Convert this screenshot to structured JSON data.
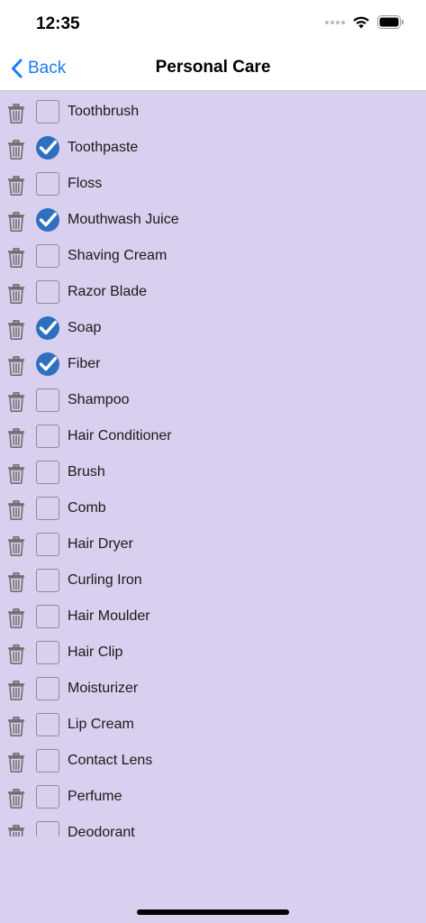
{
  "status": {
    "time": "12:35"
  },
  "nav": {
    "back_label": "Back",
    "title": "Personal Care"
  },
  "colors": {
    "accent": "#1b7cf5",
    "background": "#d9cfee",
    "check_fill": "#2f6fbf"
  },
  "items": [
    {
      "label": "Toothbrush",
      "checked": false
    },
    {
      "label": "Toothpaste",
      "checked": true
    },
    {
      "label": "Floss",
      "checked": false
    },
    {
      "label": "Mouthwash Juice",
      "checked": true
    },
    {
      "label": "Shaving Cream",
      "checked": false
    },
    {
      "label": "Razor Blade",
      "checked": false
    },
    {
      "label": "Soap",
      "checked": true
    },
    {
      "label": "Fiber",
      "checked": true
    },
    {
      "label": "Shampoo",
      "checked": false
    },
    {
      "label": "Hair Conditioner",
      "checked": false
    },
    {
      "label": "Brush",
      "checked": false
    },
    {
      "label": "Comb",
      "checked": false
    },
    {
      "label": "Hair Dryer",
      "checked": false
    },
    {
      "label": "Curling Iron",
      "checked": false
    },
    {
      "label": "Hair Moulder",
      "checked": false
    },
    {
      "label": "Hair Clip",
      "checked": false
    },
    {
      "label": "Moisturizer",
      "checked": false
    },
    {
      "label": "Lip Cream",
      "checked": false
    },
    {
      "label": "Contact Lens",
      "checked": false
    },
    {
      "label": "Perfume",
      "checked": false
    },
    {
      "label": "Deodorant",
      "checked": false
    }
  ]
}
